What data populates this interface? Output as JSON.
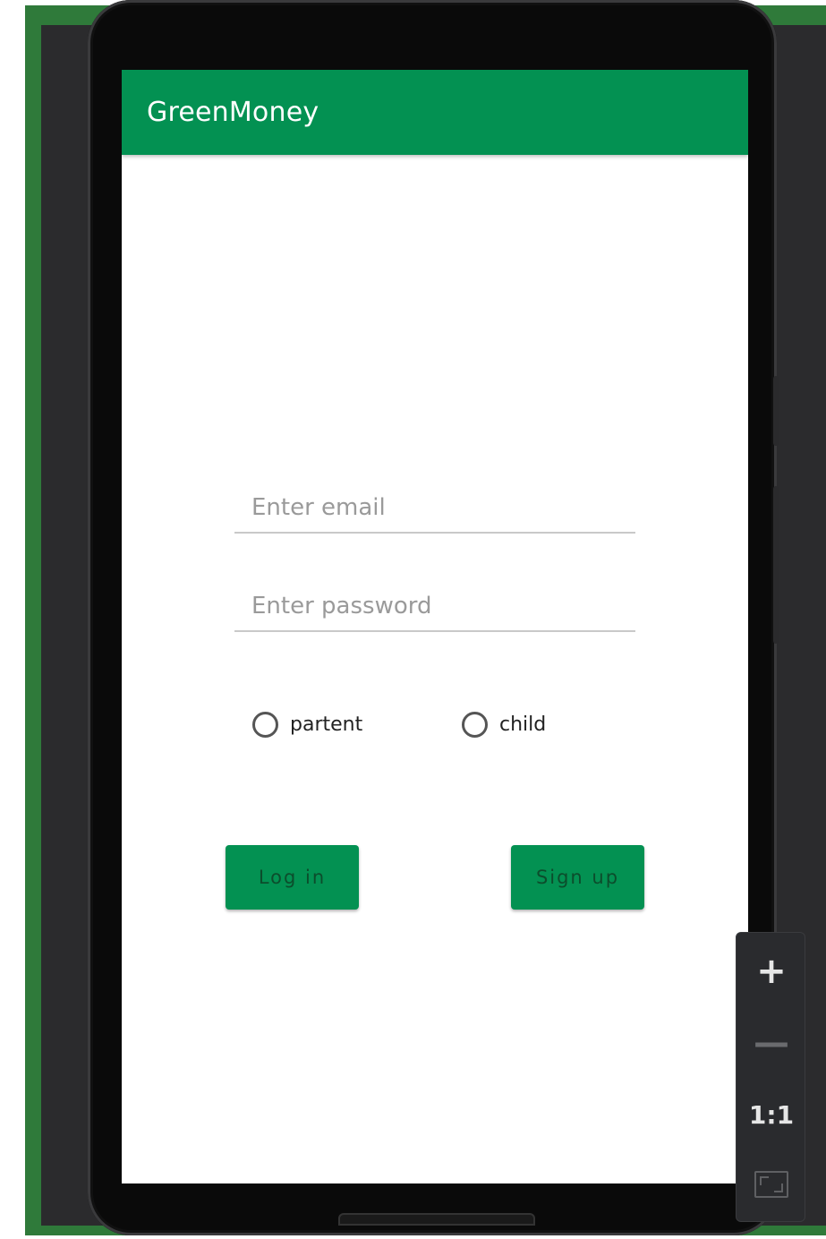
{
  "app": {
    "title": "GreenMoney"
  },
  "login_form": {
    "email_placeholder": "Enter email",
    "email_value": "",
    "password_placeholder": "Enter password",
    "password_value": "",
    "role_options": [
      {
        "label": "partent",
        "selected": false
      },
      {
        "label": "child",
        "selected": false
      }
    ],
    "login_label": "Log in",
    "signup_label": "Sign up"
  },
  "zoom_controls": {
    "zoom_in_symbol": "+",
    "zoom_out_symbol": "—",
    "reset_label": "1:1",
    "icons": [
      "plus-icon",
      "minus-icon",
      "fit-screen-icon"
    ]
  },
  "colors": {
    "brand_green": "#039152",
    "frame_green": "#2f7a3a",
    "button_text": "#0c4d2c",
    "background_dark": "#2b2b2d"
  }
}
